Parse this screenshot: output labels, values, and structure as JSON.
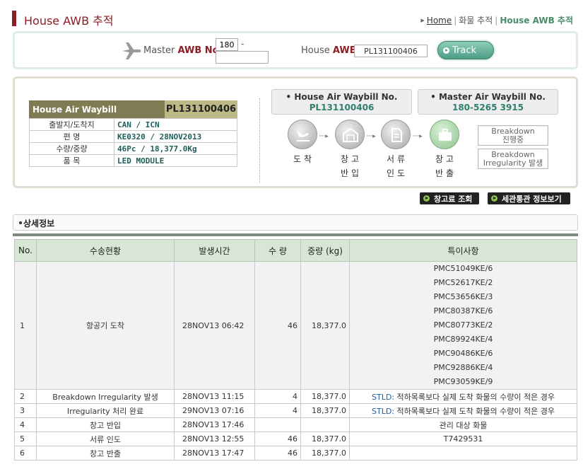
{
  "header": {
    "title": "House AWB 추적",
    "breadcrumb": {
      "home": "Home",
      "sep1": "|",
      "menu": "화물 추적",
      "sep2": "|",
      "current": "House AWB 추적"
    }
  },
  "search": {
    "master_label_prefix": "Master",
    "master_label_bold": "AWB No.",
    "master_prefix_value": "180",
    "dash": "-",
    "master_number_value": "",
    "house_label_prefix": "House",
    "house_label_bold": "AWB",
    "house_value": "PL131100406",
    "track_label": "Track"
  },
  "summary": {
    "hawb_title": "House Air Waybill",
    "hawb_number": "PL131100406",
    "rows": [
      {
        "key": "출발지/도착지",
        "value": "CAN / ICN"
      },
      {
        "key": "편 명",
        "value": "KE0320 / 28NOV2013"
      },
      {
        "key": "수량/중량",
        "value": "46Pc / 18,377.0Kg"
      },
      {
        "key": "품 목",
        "value": "LED MODULE"
      }
    ],
    "house_box": {
      "title": "House Air Waybill No.",
      "value": "PL131100406"
    },
    "master_box": {
      "title": "Master Air Waybill No.",
      "value": "180-5265 3915"
    },
    "steps": [
      {
        "line1": "도착",
        "line2": "",
        "icon": "plane-landing-icon",
        "active": false
      },
      {
        "line1": "창고",
        "line2": "반입",
        "icon": "warehouse-icon",
        "active": false
      },
      {
        "line1": "서류",
        "line2": "인도",
        "icon": "document-icon",
        "active": false
      },
      {
        "line1": "창고",
        "line2": "반출",
        "icon": "briefcase-icon",
        "active": true
      }
    ],
    "arrow": "·····▸",
    "breakdown1_line1": "Breakdown",
    "breakdown1_line2": "진행중",
    "breakdown2_line1": "Breakdown",
    "breakdown2_line2": "Irregularity 발생"
  },
  "buttons": {
    "warehouse_fee": "창고료 조회",
    "customs": "세관통관 정보보기"
  },
  "detail": {
    "title": "상세정보",
    "columns": [
      "No.",
      "수송현황",
      "발생시간",
      "수 량",
      "중량 (kg)",
      "특이사항"
    ],
    "rows": [
      {
        "no": "1",
        "status": "항공기 도착",
        "time": "28NOV13 06:42",
        "qty": "46",
        "weight": "18,377.0",
        "uld": [
          "PMC51049KE/6",
          "PMC52617KE/2",
          "PMC53656KE/3",
          "PMC80387KE/6",
          "PMC80773KE/2",
          "PMC89924KE/4",
          "PMC90486KE/6",
          "PMC92886KE/4",
          "PMC93059KE/9"
        ]
      },
      {
        "no": "2",
        "status": "Breakdown Irregularity 발생",
        "time": "28NOV13 11:15",
        "qty": "4",
        "weight": "18,377.0",
        "stld": "STLD:",
        "remark": " 적하목록보다 실제 도착 화물의 수량이 적은 경우"
      },
      {
        "no": "3",
        "status": "Irregularity 처리 완료",
        "time": "29NOV13 07:16",
        "qty": "4",
        "weight": "18,377.0",
        "stld": "STLD:",
        "remark": " 적하목록보다 실제 도착 화물의 수량이 적은 경우"
      },
      {
        "no": "4",
        "status": "창고 반입",
        "time": "28NOV13 17:46",
        "qty": "",
        "weight": "",
        "stld": "",
        "remark": "관리 대상 화물"
      },
      {
        "no": "5",
        "status": "서류 인도",
        "time": "28NOV13 12:55",
        "qty": "46",
        "weight": "18,377.0",
        "stld": "",
        "remark": "T7429531"
      },
      {
        "no": "6",
        "status": "창고 반출",
        "time": "28NOV13 17:47",
        "qty": "46",
        "weight": "18,377.0",
        "stld": "",
        "remark": ""
      }
    ]
  },
  "colors": {
    "title_red": "#8c1d25",
    "accent_green": "#4e9c87",
    "header_olive": "#7f7b52"
  }
}
